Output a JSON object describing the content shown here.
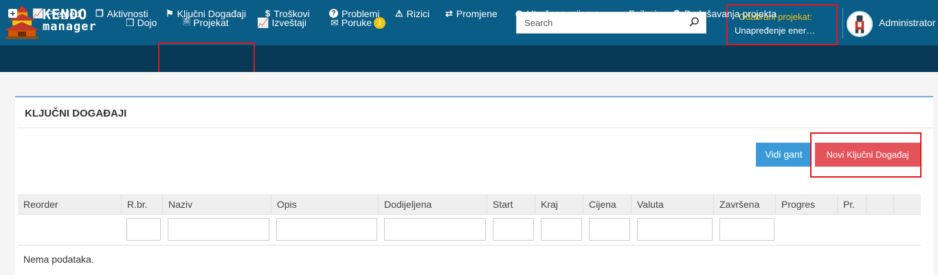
{
  "brand": {
    "line1": "KENDO",
    "line2": "manager"
  },
  "topnav": [
    {
      "icon": "copy-icon",
      "glyph": "❐",
      "label": "Dojo"
    },
    {
      "icon": "file-icon",
      "glyph": "🗎",
      "label": "Projekat"
    },
    {
      "icon": "line-chart-icon",
      "glyph": "📈",
      "label": "Izveštaji"
    },
    {
      "icon": "envelope-icon",
      "glyph": "✉",
      "label": "Poruke",
      "badge": "1"
    }
  ],
  "search": {
    "placeholder": "Search"
  },
  "project": {
    "label": "Odabrani projekat:",
    "value": "Unapređenje ener…"
  },
  "user": {
    "name": "Administrator"
  },
  "subnav": [
    {
      "glyph": "+",
      "label": ""
    },
    {
      "glyph": "📈",
      "label": "Pregled"
    },
    {
      "glyph": "❐",
      "label": "Aktivnosti"
    },
    {
      "glyph": "⚑",
      "label": "Ključni Događaji"
    },
    {
      "glyph": "$",
      "label": "Troškovi"
    },
    {
      "glyph": "?",
      "label": "Problemi"
    },
    {
      "glyph": "⚠",
      "label": "Rizici"
    },
    {
      "glyph": "⇄",
      "label": "Promjene"
    },
    {
      "glyph": "◷",
      "label": "Utrošeno vrijeme"
    },
    {
      "glyph": "▬",
      "label": "Fajlovi"
    },
    {
      "glyph": "⚙",
      "label": "Podešavanja projekta"
    }
  ],
  "panel": {
    "title": "KLJUČNI DOGAĐAJI"
  },
  "buttons": {
    "gant": "Vidi gant",
    "new": "Novi Ključni Događaj"
  },
  "table": {
    "columns": [
      "Reorder",
      "R.br.",
      "Naziv",
      "Opis",
      "Dodijeljena",
      "Start",
      "Kraj",
      "Cijena",
      "Valuta",
      "Završena",
      "Progres",
      "Pr.",
      ""
    ],
    "empty": "Nema podataka."
  },
  "colors": {
    "topbar": "#0a5d86",
    "subbar": "#083a56",
    "accent_yellow": "#f1c40f",
    "primary": "#3a9ad9",
    "danger": "#e5535a",
    "highlight": "#e3171c"
  }
}
